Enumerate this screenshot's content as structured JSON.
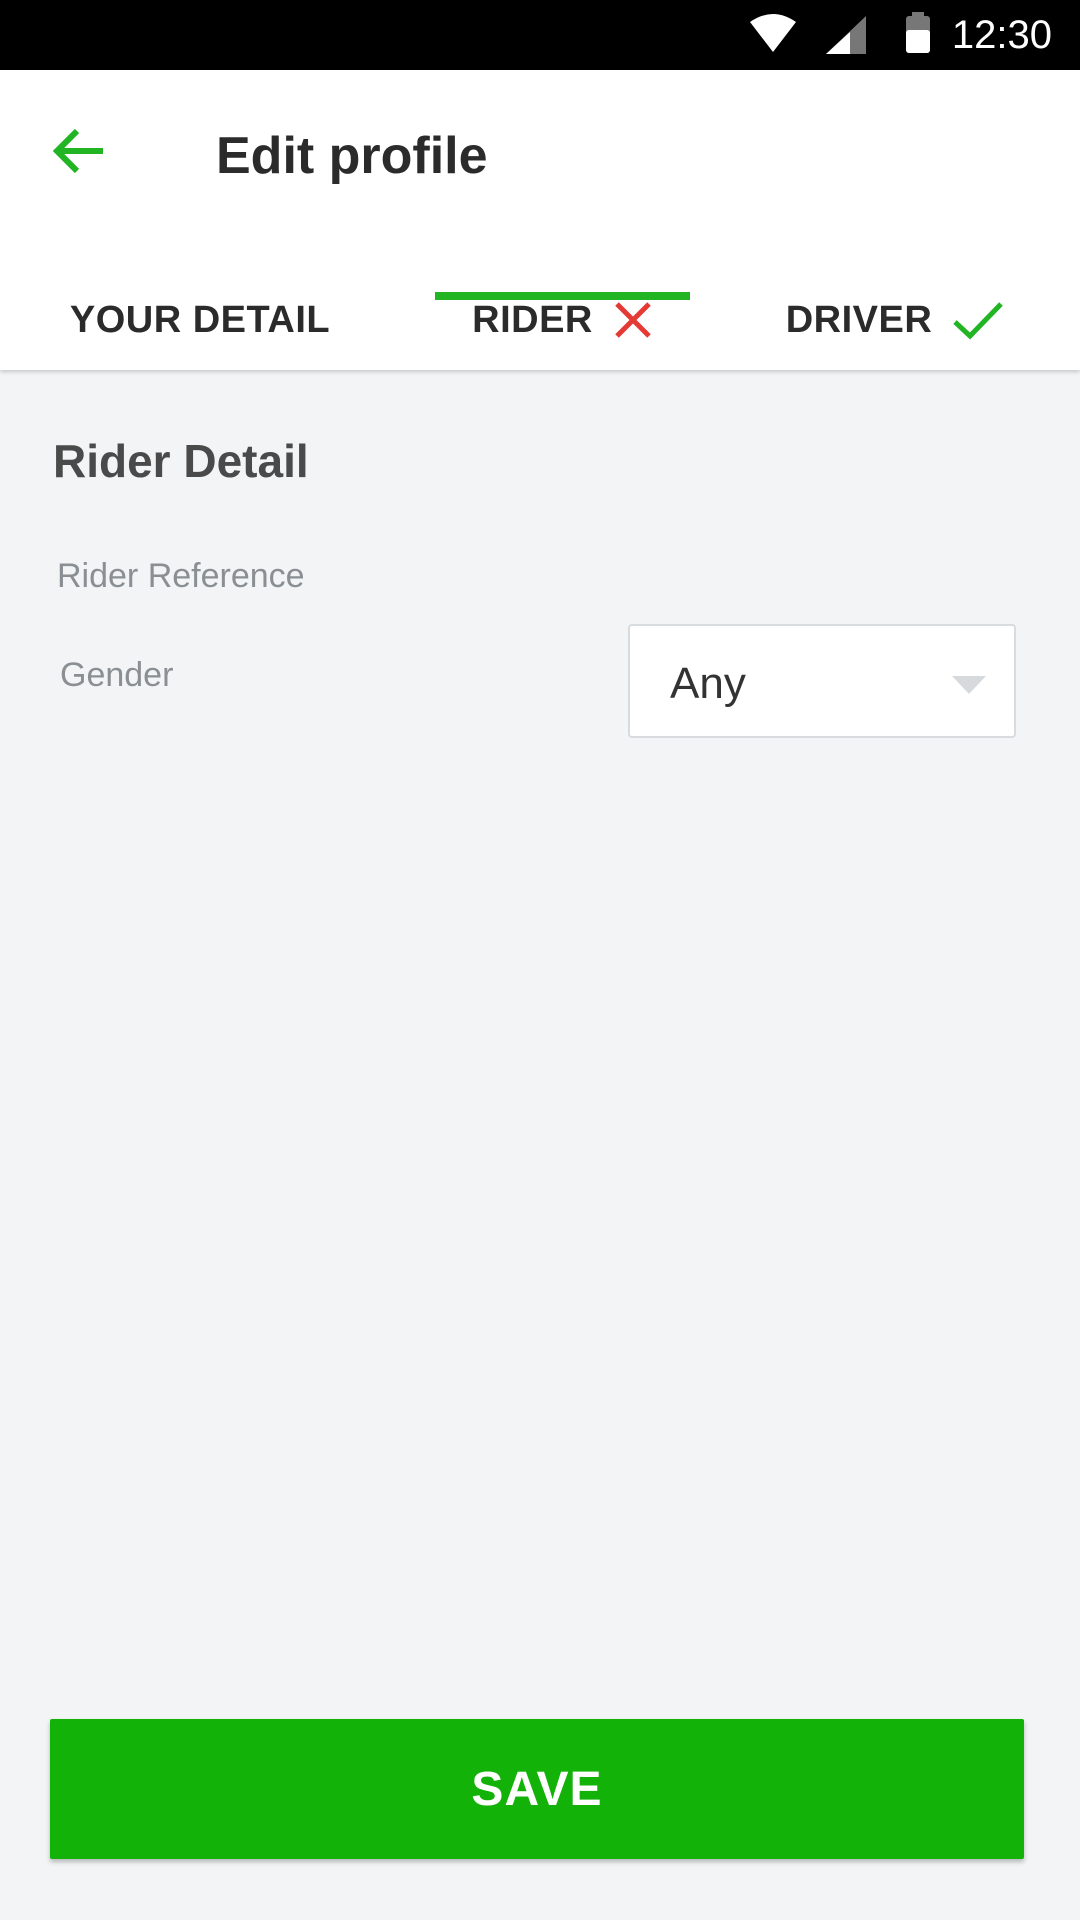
{
  "status_bar": {
    "time": "12:30",
    "icons": [
      "wifi-icon",
      "cell-signal-icon",
      "battery-icon"
    ]
  },
  "app_bar": {
    "back_icon": "arrow-left-icon",
    "title": "Edit profile"
  },
  "tabs": [
    {
      "label": "YOUR DETAIL",
      "status_icon": null,
      "selected": false
    },
    {
      "label": "RIDER",
      "status_icon": "cross-icon",
      "selected": true
    },
    {
      "label": "DRIVER",
      "status_icon": "check-icon",
      "selected": false
    }
  ],
  "rider_detail": {
    "section_title": "Rider Detail",
    "reference_label": "Rider Reference",
    "gender_label": "Gender",
    "gender_value": "Any"
  },
  "save_button": {
    "label": "SAVE"
  },
  "colors": {
    "accent_green": "#21b524",
    "save_green": "#12b208",
    "error_red": "#e53935",
    "background": "#f2f4f6"
  }
}
